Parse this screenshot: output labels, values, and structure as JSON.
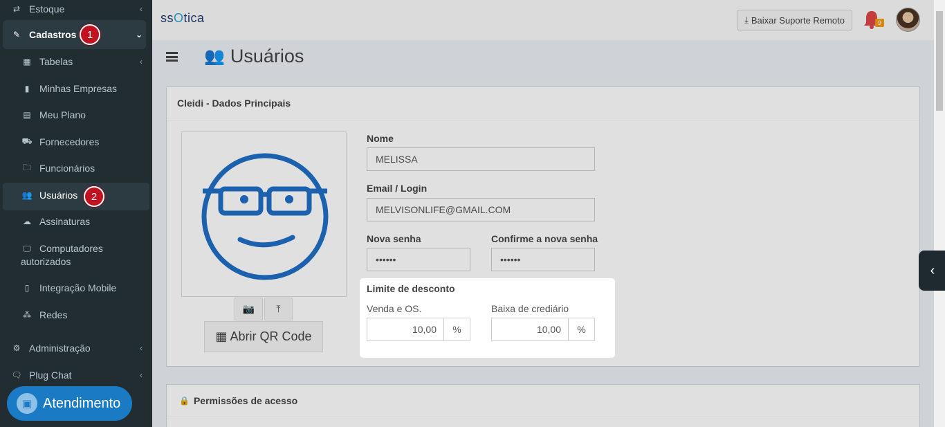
{
  "sidebar": {
    "estoque": "Estoque",
    "cadastros": "Cadastros",
    "cadastros_step": "1",
    "tabelas": "Tabelas",
    "minhas_empresas": "Minhas Empresas",
    "meu_plano": "Meu Plano",
    "fornecedores": "Fornecedores",
    "funcionarios": "Funcionários",
    "usuarios": "Usuários",
    "usuarios_step": "2",
    "assinaturas": "Assinaturas",
    "computadores": "Computadores",
    "computadores2": "autorizados",
    "integracao": "Integração Mobile",
    "redes": "Redes",
    "administracao": "Administração",
    "plugchat": "Plug Chat",
    "atendimento": "Atendimento"
  },
  "header": {
    "logo_prefix": "ss",
    "logo_o": "O",
    "logo_suffix": "tica",
    "suporte": "Baixar Suporte Remoto",
    "notif_count": "9"
  },
  "page": {
    "title": "Usuários"
  },
  "form": {
    "box_title": "Cleidi - Dados Principais",
    "qr_label": "Abrir QR Code",
    "nome_label": "Nome",
    "nome_value": "MELISSA",
    "email_label": "Email / Login",
    "email_value": "MELVISONLIFE@GMAIL.COM",
    "senha_label": "Nova senha",
    "senha_value": "••••••",
    "confirma_label": "Confirme a nova senha",
    "confirma_value": "••••••"
  },
  "desconto": {
    "title": "Limite de desconto",
    "venda_label": "Venda e OS.",
    "venda_value": "10,00",
    "baixa_label": "Baixa de crediário",
    "baixa_value": "10,00",
    "unit": "%"
  },
  "permissoes": {
    "title": "Permissões de acesso"
  },
  "colors": {
    "sidebar_bg": "#222d32",
    "accent": "#1a7ac4",
    "step_badge": "#c1121f"
  }
}
